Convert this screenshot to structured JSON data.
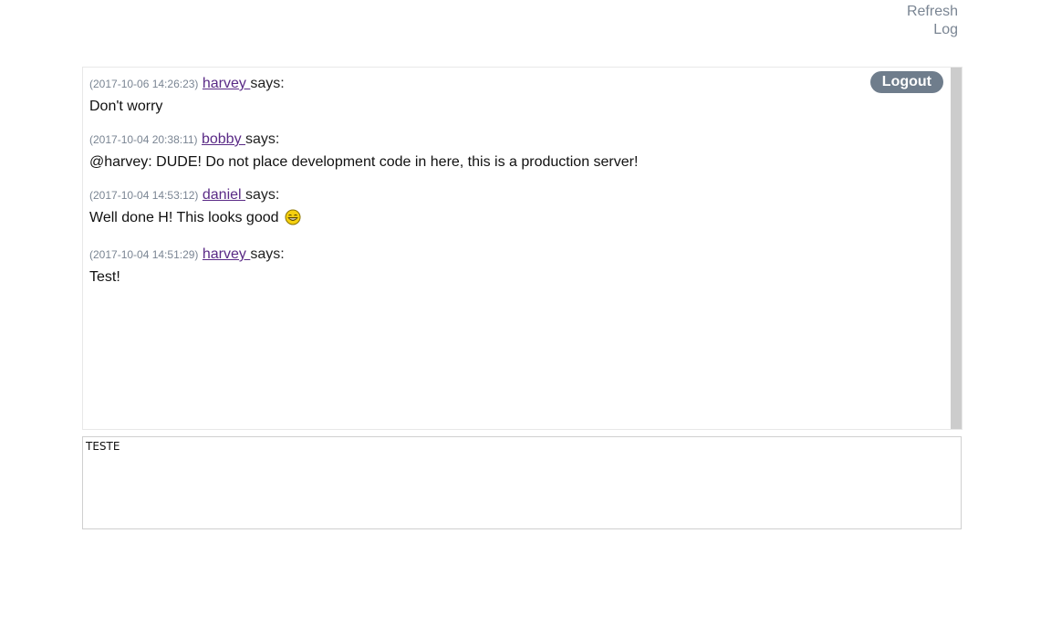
{
  "links": {
    "refresh": "Refresh",
    "log": "Log"
  },
  "logout_label": "Logout",
  "messages": [
    {
      "timestamp": "(2017-10-06 14:26:23)",
      "user": "harvey ",
      "says": "says:",
      "text": "Don't worry"
    },
    {
      "timestamp": "(2017-10-04 20:38:11)",
      "user": "bobby ",
      "says": "says:",
      "text": "@harvey: DUDE! Do not place development code in here, this is a production server!"
    },
    {
      "timestamp": "(2017-10-04 14:53:12)",
      "user": "daniel ",
      "says": "says:",
      "text": "Well done H! This looks good ",
      "emoji": "smiley-icon"
    },
    {
      "timestamp": "(2017-10-04 14:51:29)",
      "user": "harvey ",
      "says": "says:",
      "text": "Test!"
    }
  ],
  "input": {
    "value": "TESTE"
  },
  "colors": {
    "link_gray": "#7a8593",
    "username": "#5a2a86",
    "logout_bg": "#6f7d8c",
    "scrollbar": "#cccccc"
  }
}
